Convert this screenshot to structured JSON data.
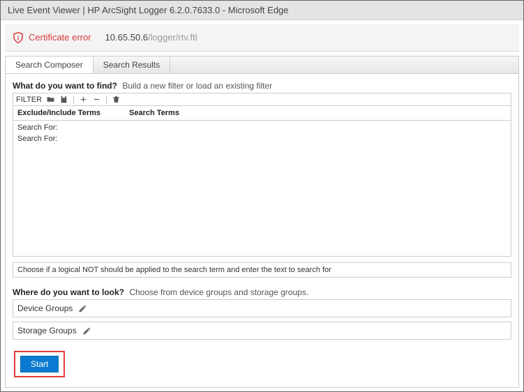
{
  "window": {
    "title": "Live Event Viewer | HP ArcSight Logger 6.2.0.7633.0 - Microsoft Edge"
  },
  "address": {
    "cert_label": "Certificate error",
    "host": "10.65.50.6",
    "path": "/logger/rtv.ftl"
  },
  "tabs": {
    "composer": "Search Composer",
    "results": "Search Results"
  },
  "find": {
    "question": "What do you want to find?",
    "hint": "Build a new filter or load an existing filter",
    "filter_label": "FILTER",
    "col_exc": "Exclude/Include Terms",
    "col_terms": "Search Terms",
    "row1": "Search For:",
    "row2": "Search For:",
    "bottom_hint": "Choose if a logical NOT should be applied to the search term and enter the text to search for"
  },
  "look": {
    "question": "Where do you want to look?",
    "hint": "Choose from device groups and storage groups.",
    "device": "Device Groups",
    "storage": "Storage Groups"
  },
  "actions": {
    "start": "Start"
  }
}
